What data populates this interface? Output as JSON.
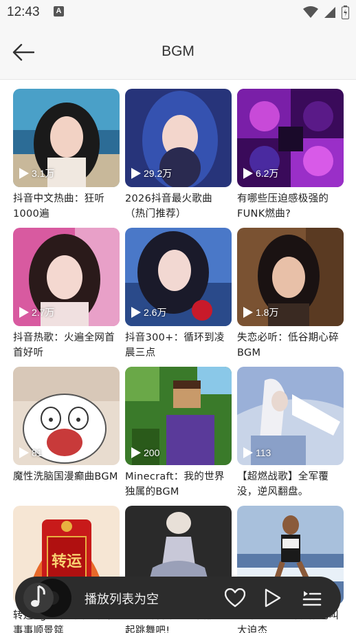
{
  "status_bar": {
    "time": "12:43",
    "notification_badge": "A"
  },
  "header": {
    "title": "BGM"
  },
  "playlists": [
    {
      "title": "抖音中文热曲：狂听1000遍",
      "plays": "3.1万",
      "theme": "#5aa8c8"
    },
    {
      "title": "2026抖音最火歌曲（热门推荐）",
      "plays": "29.2万",
      "theme": "#2a3f8c"
    },
    {
      "title": "有哪些压迫感极强的FUNK燃曲?",
      "plays": "6.2万",
      "theme": "#7a2bb0"
    },
    {
      "title": "抖音热歌：火遍全网首首好听",
      "plays": "2.7万",
      "theme": "#c24d8a"
    },
    {
      "title": "抖音300+：循环到凌晨三点",
      "plays": "2.6万",
      "theme": "#4a6fb5"
    },
    {
      "title": "失恋必听：低谷期心碎BGM",
      "plays": "1.8万",
      "theme": "#8a5a3a"
    },
    {
      "title": "魔性洗脑国漫癫曲BGM",
      "plays": "81",
      "theme": "#e8d8c8"
    },
    {
      "title": "Minecraft：我的世界独属的BGM",
      "plays": "200",
      "theme": "#4a8a3a"
    },
    {
      "title": "【超燃战歌】全军覆没，逆风翻盘。",
      "plays": "113",
      "theme": "#9aa8c8"
    },
    {
      "title": "转运bgm｜发财暴富，事事顺景筵",
      "plays": "",
      "theme": "#f0c8a0"
    },
    {
      "title": "【跳舞合集】让我们一起跳舞吧!",
      "plays": "",
      "theme": "#3a3a3a"
    },
    {
      "title": "【早长跑】听说你也叫大迫杰",
      "plays": "",
      "theme": "#8ab0d8"
    }
  ],
  "cover_text": {
    "lucky": "转运"
  },
  "player": {
    "status_text": "播放列表为空",
    "icons": [
      "music-disc-icon",
      "heart-icon",
      "play-icon",
      "playlist-icon"
    ]
  }
}
